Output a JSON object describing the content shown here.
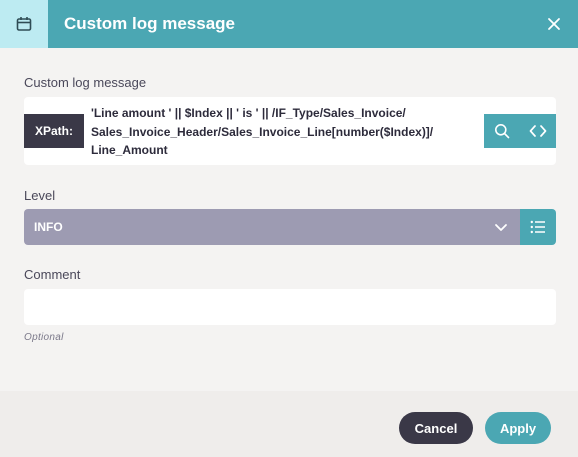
{
  "header": {
    "title": "Custom log message",
    "icon": "calendar-icon",
    "close_icon": "close-icon"
  },
  "log_message": {
    "label": "Custom log message",
    "tag": "XPath:",
    "lines": [
      "'Line amount ' || $Index || ' is ' || /IF_Type/Sales_Invoice/",
      "Sales_Invoice_Header/Sales_Invoice_Line[number($Index)]/",
      "Line_Amount"
    ],
    "search_icon": "search-icon",
    "code_icon": "code-icon"
  },
  "level": {
    "label": "Level",
    "value": "INFO",
    "chevron_icon": "chevron-down-icon",
    "list_icon": "list-icon"
  },
  "comment": {
    "label": "Comment",
    "value": "",
    "hint": "Optional"
  },
  "footer": {
    "cancel_label": "Cancel",
    "apply_label": "Apply"
  },
  "colors": {
    "accent": "#4ba7b3",
    "accent_light": "#bdebf2",
    "dark": "#3a3847",
    "select_bg": "#9d9bb2"
  }
}
